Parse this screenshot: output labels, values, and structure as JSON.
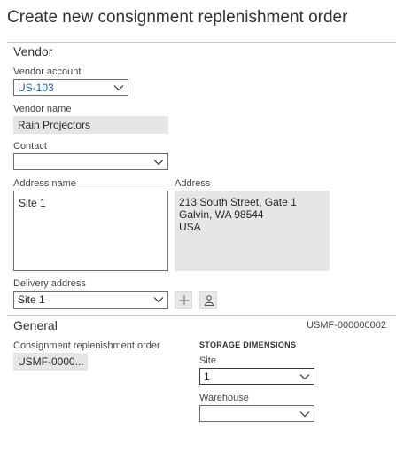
{
  "page": {
    "title": "Create new consignment replenishment order"
  },
  "vendor": {
    "section_title": "Vendor",
    "vendor_account": {
      "label": "Vendor account",
      "value": "US-103"
    },
    "vendor_name": {
      "label": "Vendor name",
      "value": "Rain Projectors"
    },
    "contact": {
      "label": "Contact",
      "value": ""
    },
    "address_name": {
      "label": "Address name",
      "value": "Site 1"
    },
    "address": {
      "label": "Address",
      "line1": "213 South Street, Gate 1",
      "line2": "Galvin, WA 98544",
      "line3": "USA"
    },
    "delivery_address": {
      "label": "Delivery address",
      "value": "Site 1"
    }
  },
  "general": {
    "section_title": "General",
    "order_id_summary": "USMF-000000002",
    "consignment_order": {
      "label": "Consignment replenishment order",
      "value": "USMF-0000..."
    },
    "storage_dimensions": {
      "heading": "STORAGE DIMENSIONS",
      "site": {
        "label": "Site",
        "value": "1"
      },
      "warehouse": {
        "label": "Warehouse",
        "value": ""
      }
    }
  },
  "colors": {
    "link": "#1f5aa6",
    "readonly_bg": "#e6e6e6",
    "border": "#6e6e6e"
  }
}
